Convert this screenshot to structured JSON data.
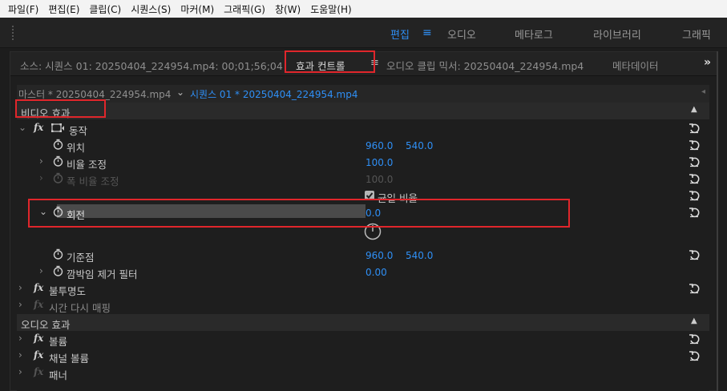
{
  "menu": [
    "파일(F)",
    "편집(E)",
    "클립(C)",
    "시퀀스(S)",
    "마커(M)",
    "그래픽(G)",
    "창(W)",
    "도움말(H)"
  ],
  "workspaces": [
    {
      "label": "편집",
      "active": true
    },
    {
      "label": "오디오",
      "active": false
    },
    {
      "label": "메타로그",
      "active": false
    },
    {
      "label": "라이브러리",
      "active": false
    },
    {
      "label": "그래픽",
      "active": false
    }
  ],
  "tabs": {
    "source": "소스: 시퀀스 01: 20250404_224954.mp4: 00;01;56;04",
    "effect_controls": "효과 컨트롤",
    "audio_mixer": "오디오 클립 믹서: 20250404_224954.mp4",
    "metadata": "메타데이터",
    "overflow": "»"
  },
  "sequence": {
    "master": "마스터 * 20250404_224954.mp4",
    "current": "시퀀스 01 * 20250404_224954.mp4"
  },
  "video_effects_label": "비디오 효과",
  "audio_effects_label": "오디오 효과",
  "motion": {
    "label": "동작",
    "position": {
      "label": "위치",
      "x": "960.0",
      "y": "540.0"
    },
    "scale": {
      "label": "비율 조정",
      "value": "100.0"
    },
    "scale_width": {
      "label": "폭 비율 조정",
      "value": "100.0"
    },
    "uniform_scale": {
      "label": "균일 비율",
      "checked": true
    },
    "rotation": {
      "label": "회전",
      "value": "0.0"
    },
    "anchor": {
      "label": "기준점",
      "x": "960.0",
      "y": "540.0"
    },
    "flicker": {
      "label": "깜박임 제거 필터",
      "value": "0.00"
    }
  },
  "opacity_label": "불투명도",
  "time_remap_label": "시간 다시 매핑",
  "volume_label": "볼륨",
  "channel_volume_label": "채널 볼륨",
  "panner_label": "패너",
  "colors": {
    "accent": "#2f8ff5",
    "annotation": "#e0262b"
  }
}
